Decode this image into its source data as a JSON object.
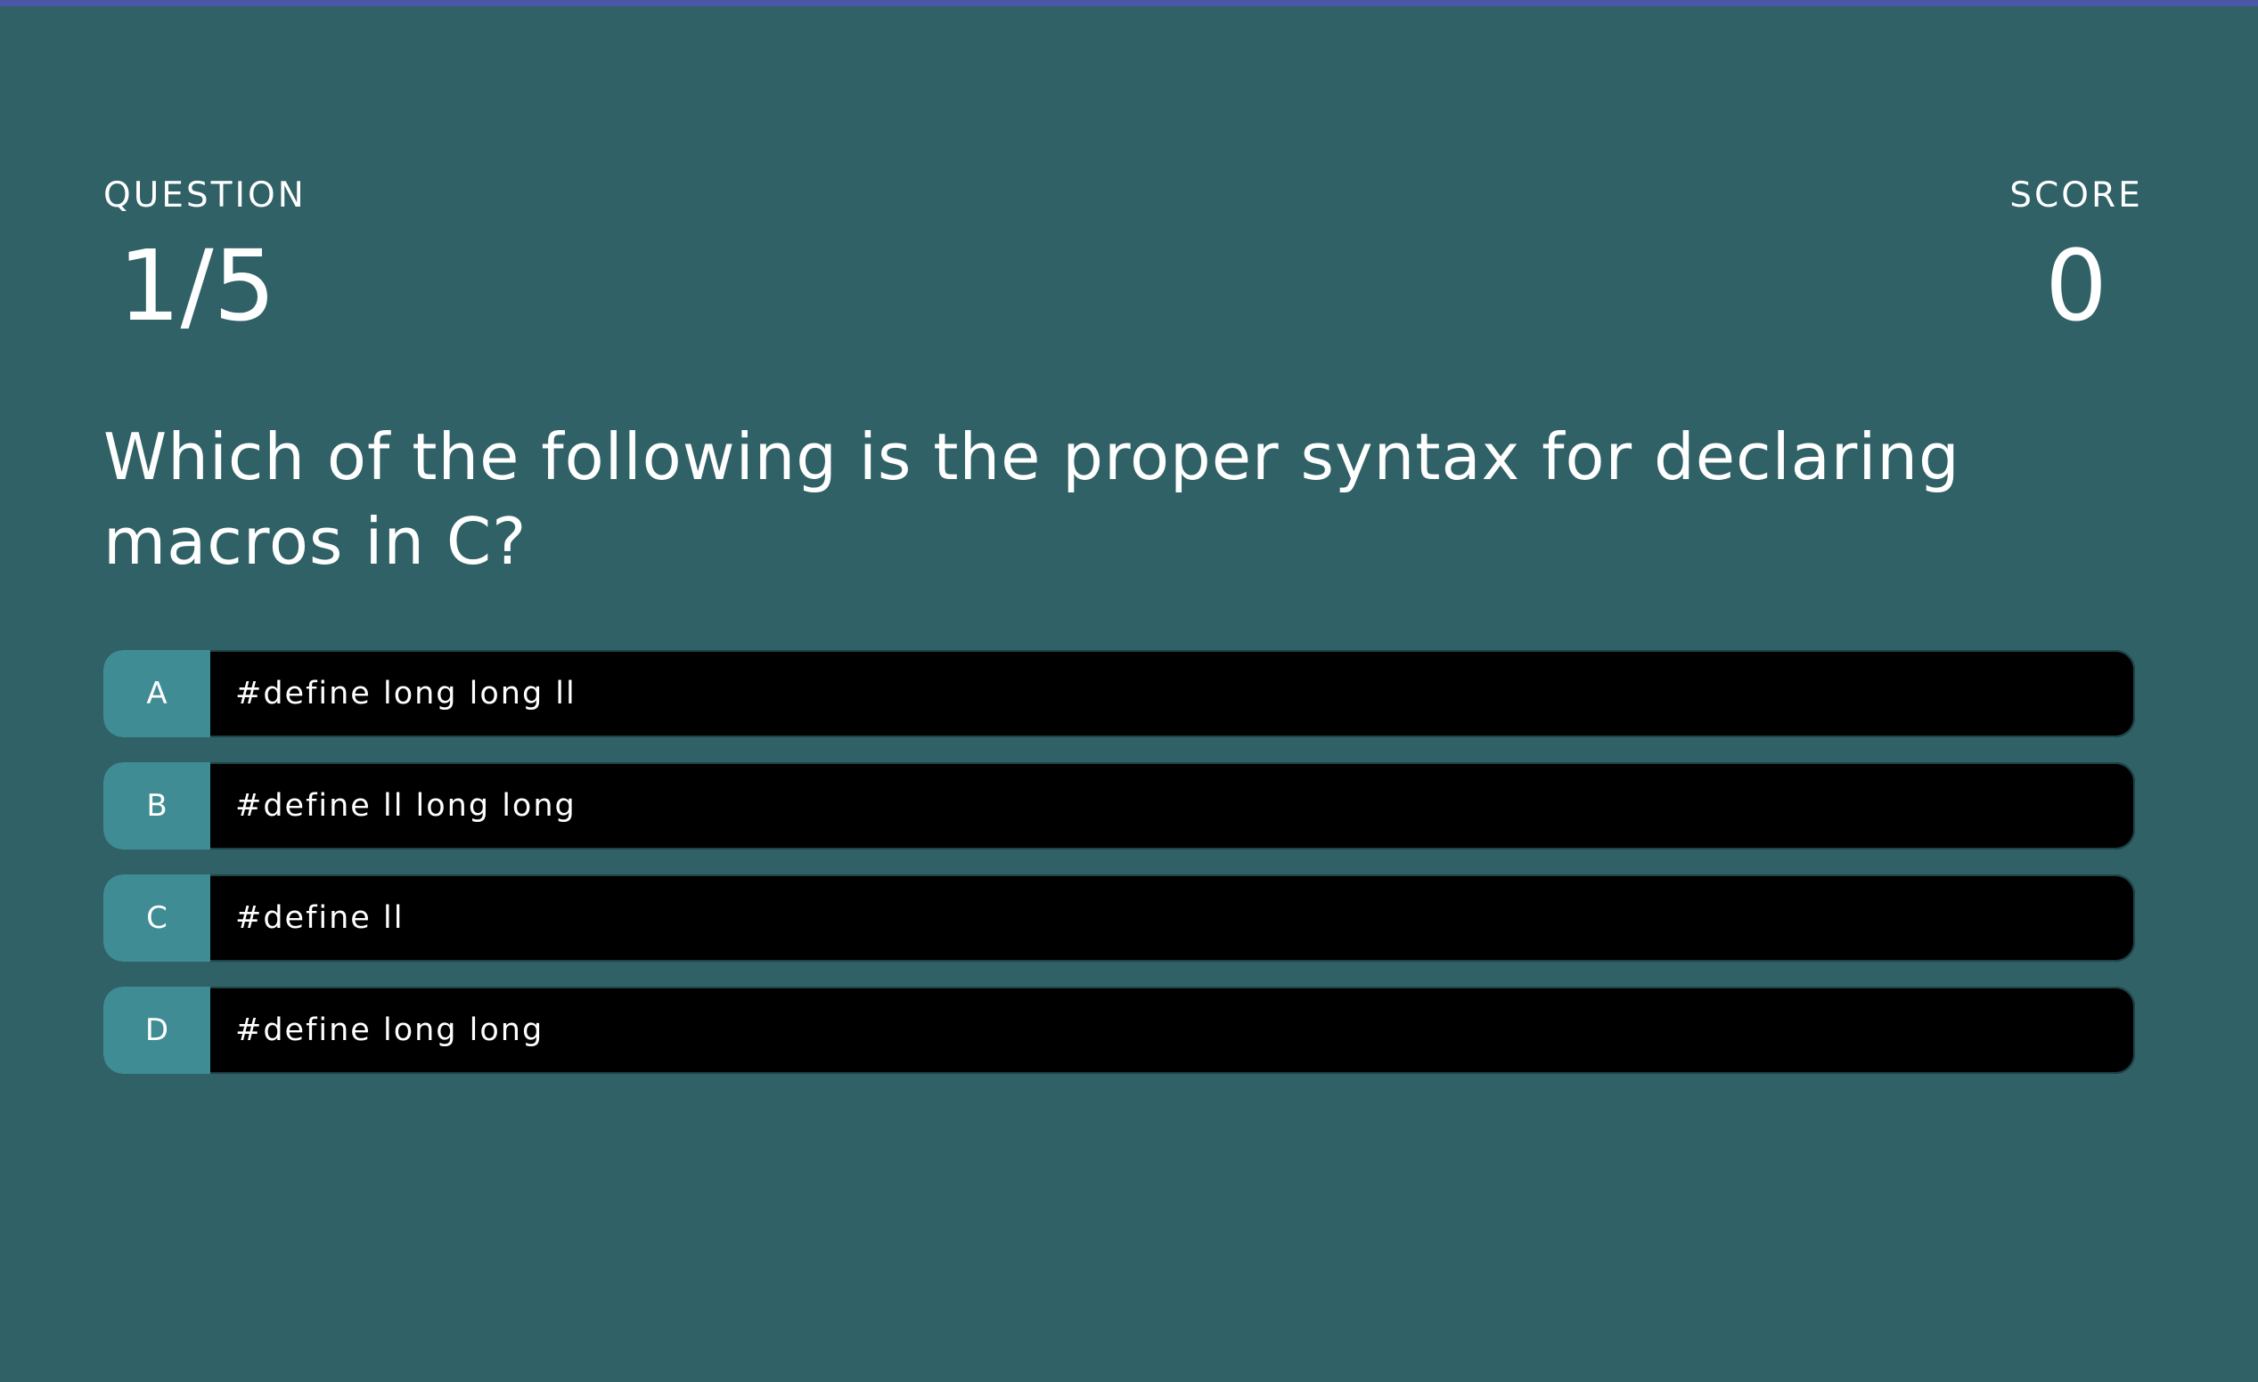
{
  "header": {
    "question_label": "QUESTION",
    "question_progress": "1/5",
    "score_label": "SCORE",
    "score_value": "0"
  },
  "question": {
    "text": "Which of the following is the proper syntax for declaring macros in C?"
  },
  "options": [
    {
      "letter": "A",
      "text": "#define long long ll"
    },
    {
      "letter": "B",
      "text": "#define ll long long"
    },
    {
      "letter": "C",
      "text": "#define ll"
    },
    {
      "letter": "D",
      "text": "#define long long"
    }
  ],
  "colors": {
    "background": "#2f6166",
    "top_strip": "#4a56a6",
    "option_letter_bg": "#3f8c94",
    "option_bg": "#000000",
    "text": "#ffffff"
  }
}
